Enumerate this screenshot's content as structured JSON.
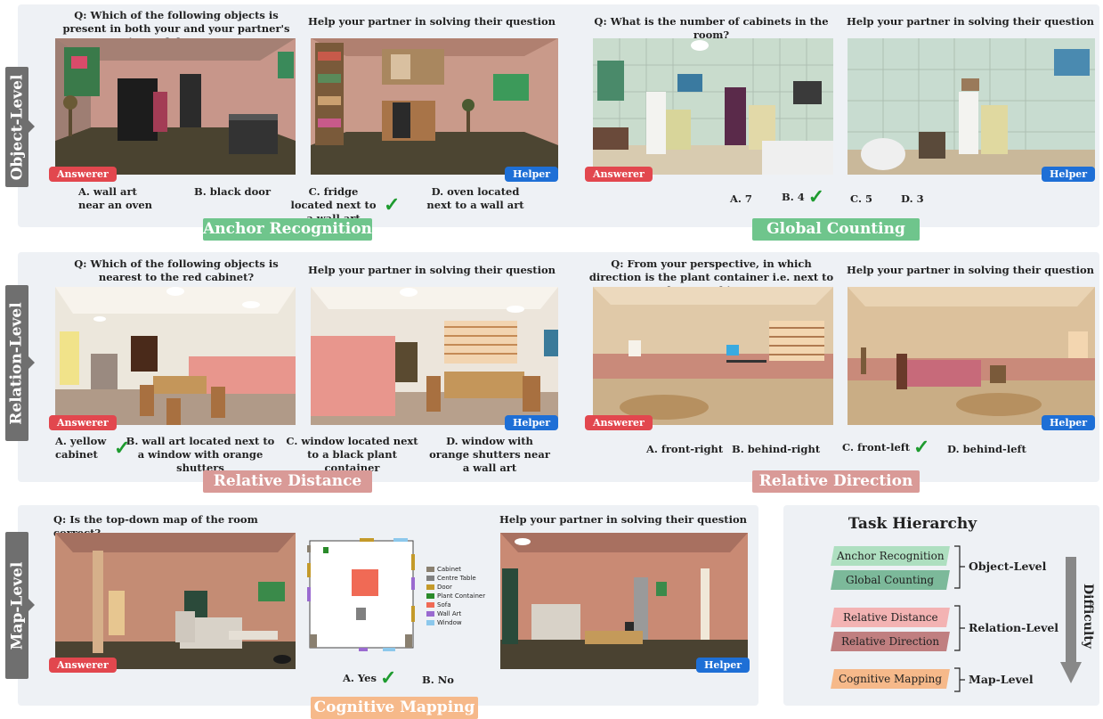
{
  "levels": {
    "object": "Object-Level",
    "relation": "Relation-Level",
    "map": "Map-Level"
  },
  "helper_prompt": "Help your partner in solving their question",
  "badges": {
    "answerer": "Answerer",
    "helper": "Helper"
  },
  "check_mark": "✓",
  "anchor": {
    "question": "Q: Which of the following objects is present in both your and your partner's views of the room?",
    "options": [
      "A. wall art near an oven",
      "B. black door",
      "C. fridge located next to a wall art",
      "D. oven located next to a wall art"
    ],
    "category": "Anchor Recognition"
  },
  "counting": {
    "question": "Q: What is the number of cabinets in the room?",
    "options": [
      "A. 7",
      "B. 4",
      "C. 5",
      "D. 3"
    ],
    "category": "Global Counting"
  },
  "distance": {
    "question": "Q: Which of the following objects is nearest to the red cabinet?",
    "options": [
      "A. yellow cabinet",
      "B. wall art located next to a window with orange shutters",
      "C. window located next to a black plant container",
      "D. window with orange shutters near a wall art"
    ],
    "category": "Relative Distance"
  },
  "direction": {
    "question": "Q: From your perspective, in which direction is the plant container i.e. next to brown cabinet?",
    "options": [
      "A. front-right",
      "B. behind-right",
      "C. front-left",
      "D. behind-left"
    ],
    "category": "Relative Direction"
  },
  "mapping": {
    "question": "Q: Is the top-down map of the room correct?",
    "options": [
      "A. Yes",
      "B. No"
    ],
    "category": "Cognitive Mapping",
    "legend": [
      {
        "label": "Cabinet",
        "color": "#8a8070"
      },
      {
        "label": "Centre Table",
        "color": "#808080"
      },
      {
        "label": "Door",
        "color": "#c49a2a"
      },
      {
        "label": "Plant Container",
        "color": "#2a8a2a"
      },
      {
        "label": "Sofa",
        "color": "#f06a55"
      },
      {
        "label": "Wall Art",
        "color": "#9a6ad0"
      },
      {
        "label": "Window",
        "color": "#8cc8ec"
      }
    ]
  },
  "hierarchy": {
    "title": "Task Hierarchy",
    "items": [
      "Anchor Recognition",
      "Global Counting",
      "Relative Distance",
      "Relative Direction",
      "Cognitive Mapping"
    ],
    "groups": [
      "Object-Level",
      "Relation-Level",
      "Map-Level"
    ],
    "axis_label": "Difficulty"
  },
  "colors": {
    "anchor": "#6fc58c",
    "counting": "#6fc58c",
    "distance": "#d99a97",
    "direction": "#d99a97",
    "mapping": "#f6b98a",
    "hier_anchor": "#aedfc0",
    "hier_counting": "#7cb99a",
    "hier_distance": "#f3b3b3",
    "hier_direction": "#c07f80",
    "hier_mapping": "#f6b98a"
  }
}
